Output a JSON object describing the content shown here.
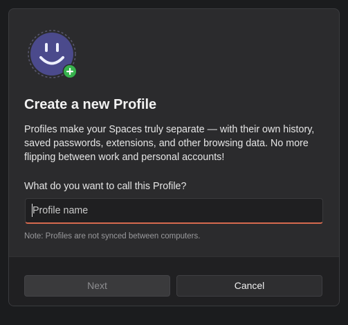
{
  "dialog": {
    "title": "Create a new Profile",
    "description": "Profiles make your Spaces truly separate — with their own history, saved passwords, extensions, and other browsing data. No more flipping between work and personal accounts!",
    "field_label": "What do you want to call this Profile?",
    "input": {
      "placeholder": "Profile name",
      "value": ""
    },
    "note": "Note: Profiles are not synced between computers.",
    "buttons": {
      "next_label": "Next",
      "cancel_label": "Cancel"
    },
    "avatar_icon": "smiley-face-icon",
    "badge_icon": "plus-icon"
  },
  "colors": {
    "dialog_bg": "#2b2b2d",
    "footer_bg": "#202022",
    "avatar_fill": "#4b4a8c",
    "badge_green": "#37b24d",
    "input_accent": "#d66a4f"
  }
}
